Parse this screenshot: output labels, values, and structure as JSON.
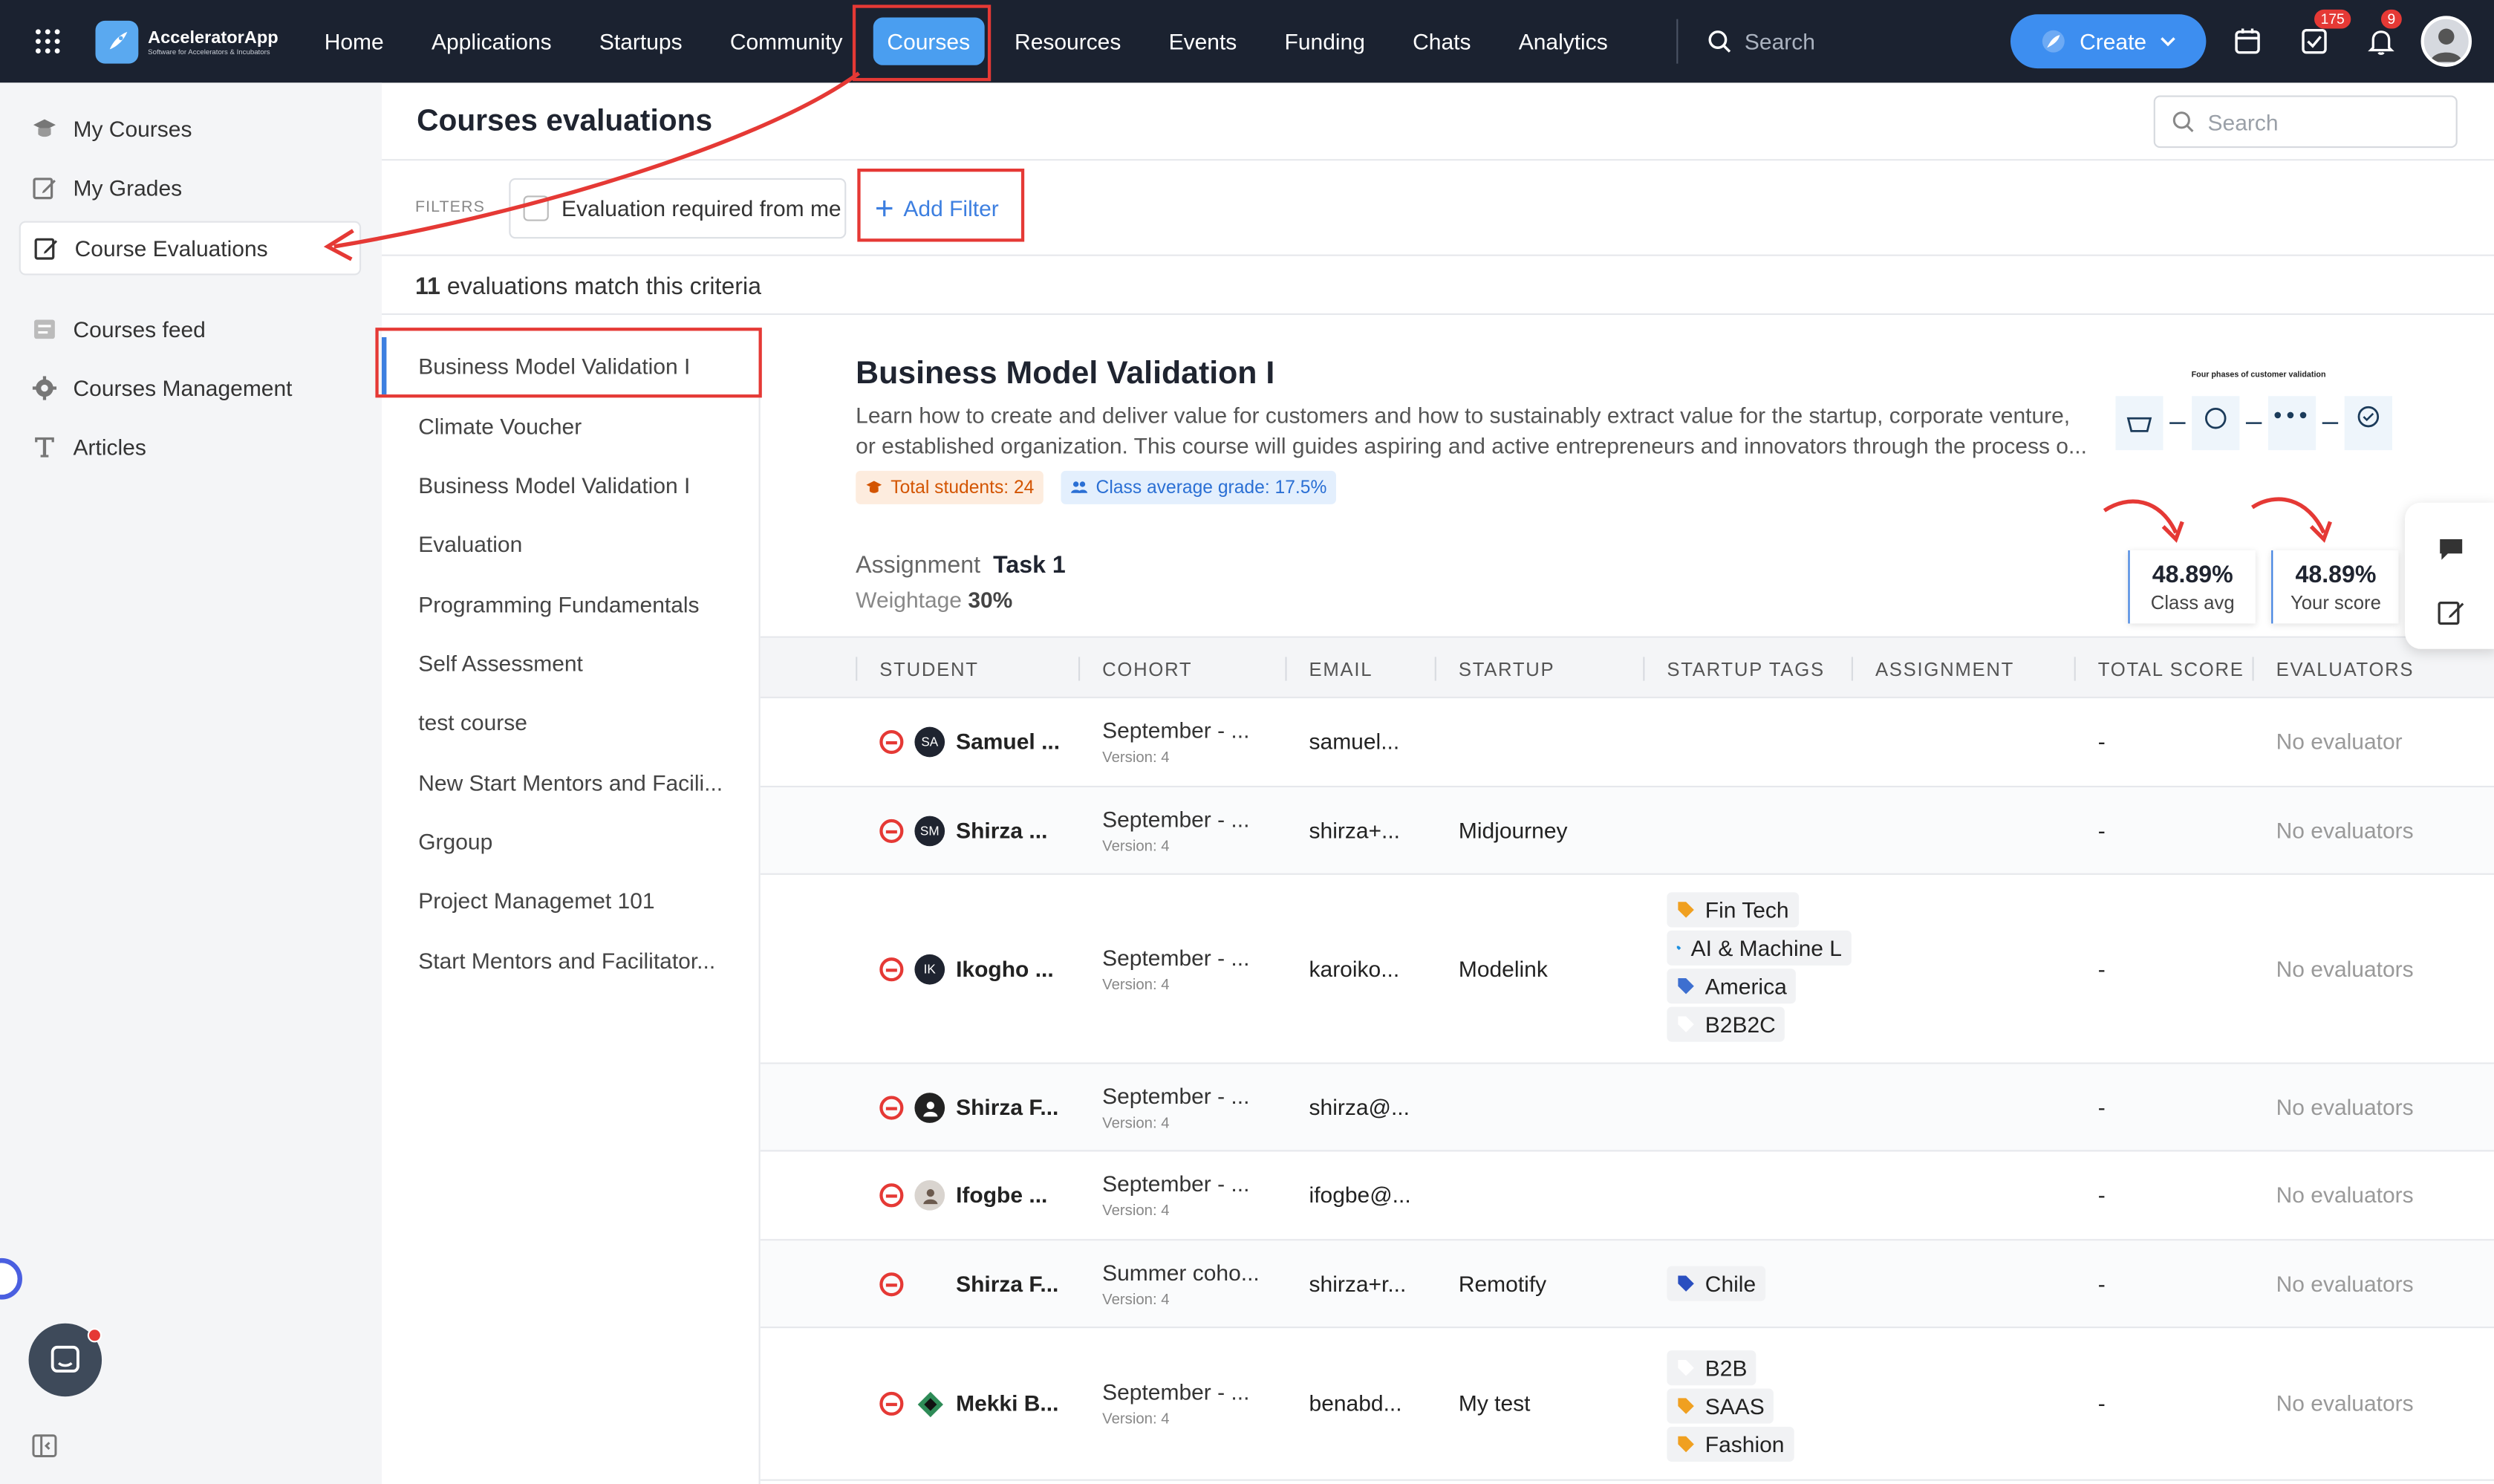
{
  "app": {
    "name": "AcceleratorApp",
    "tagline": "Software for Accelerators & Incubators"
  },
  "topnav": {
    "items": [
      {
        "label": "Home"
      },
      {
        "label": "Applications"
      },
      {
        "label": "Startups"
      },
      {
        "label": "Community"
      },
      {
        "label": "Courses",
        "active": true
      },
      {
        "label": "Resources"
      },
      {
        "label": "Events"
      },
      {
        "label": "Funding"
      },
      {
        "label": "Chats"
      },
      {
        "label": "Analytics"
      }
    ],
    "search_placeholder": "Search",
    "create_label": "Create",
    "tasks_badge": "175",
    "notifications_badge": "9"
  },
  "sidebar": {
    "items": [
      {
        "label": "My Courses",
        "icon": "graduation-icon"
      },
      {
        "label": "My Grades",
        "icon": "edit-icon"
      },
      {
        "label": "Course Evaluations",
        "icon": "edit-icon",
        "selected": true
      },
      {
        "label": "Courses feed",
        "icon": "feed-icon"
      },
      {
        "label": "Courses Management",
        "icon": "gear-icon"
      },
      {
        "label": "Articles",
        "icon": "text-icon"
      }
    ]
  },
  "main": {
    "title": "Courses evaluations",
    "search_placeholder": "Search",
    "filters_label": "FILTERS",
    "filter_checkbox_label": "Evaluation required from me",
    "add_filter_label": "Add Filter",
    "match_count": "11",
    "match_text": " evaluations match this criteria"
  },
  "courses": [
    "Business Model Validation I",
    "Climate Voucher",
    "Business Model Validation I",
    "Evaluation",
    "Programming Fundamentals",
    "Self Assessment",
    "test course",
    "New Start Mentors and Facili...",
    "Grgoup",
    "Project Managemet 101",
    "Start Mentors and Facilitator..."
  ],
  "detail": {
    "title": "Business Model Validation I",
    "description": "Learn how to create and deliver value for customers and how to sustainably extract value for the startup, corporate venture, or established organization. This course will guides aspiring and active entrepreneurs and innovators through the process o...",
    "total_students": "Total students: 24",
    "class_avg_grade": "Class average grade: 17.5%",
    "diagram_title": "Four phases of customer validation",
    "assignment_label": "Assignment",
    "assignment_name": "Task 1",
    "weightage_label": "Weightage",
    "weightage_value": "30%",
    "class_avg_value": "48.89%",
    "class_avg_label": "Class avg",
    "your_score_value": "48.89%",
    "your_score_label": "Your score"
  },
  "table": {
    "columns": [
      "STUDENT",
      "COHORT",
      "EMAIL",
      "STARTUP",
      "STARTUP TAGS",
      "ASSIGNMENT",
      "TOTAL SCORE",
      "EVALUATORS"
    ],
    "version_text": "Version: 4",
    "rows": [
      {
        "initials": "SA",
        "name": "Samuel ...",
        "cohort": "September - ...",
        "email": "samuel...",
        "startup": "",
        "tags": [],
        "score": "-",
        "evaluators": "No evaluator"
      },
      {
        "initials": "SM",
        "name": "Shirza ...",
        "cohort": "September - ...",
        "email": "shirza+...",
        "startup": "Midjourney",
        "tags": [],
        "score": "-",
        "evaluators": "No evaluators"
      },
      {
        "initials": "IK",
        "name": "Ikogho ...",
        "cohort": "September - ...",
        "email": "karoiko...",
        "startup": "Modelink",
        "tags": [
          {
            "label": "Fin Tech",
            "color": "#f0a020"
          },
          {
            "label": "AI & Machine L",
            "color": "#1e90e0"
          },
          {
            "label": "America",
            "color": "#3d6fd0"
          },
          {
            "label": "B2B2C",
            "color": "#ffffff"
          }
        ],
        "score": "-",
        "evaluators": "No evaluators"
      },
      {
        "initials": "",
        "name": "Shirza F...",
        "cohort": "September - ...",
        "email": "shirza@...",
        "startup": "",
        "tags": [],
        "score": "-",
        "evaluators": "No evaluators"
      },
      {
        "initials": "",
        "name": "Ifogbe ...",
        "cohort": "September - ...",
        "email": "ifogbe@...",
        "startup": "",
        "tags": [],
        "score": "-",
        "evaluators": "No evaluators"
      },
      {
        "initials": "",
        "name": "Shirza F...",
        "cohort": "Summer coho...",
        "email": "shirza+r...",
        "startup": "Remotify",
        "tags": [
          {
            "label": "Chile",
            "color": "#2a4fc0"
          }
        ],
        "score": "-",
        "evaluators": "No evaluators"
      },
      {
        "initials": "",
        "name": "Mekki B...",
        "cohort": "September - ...",
        "email": "benabd...",
        "startup": "My test",
        "tags": [
          {
            "label": "B2B",
            "color": "#ffffff"
          },
          {
            "label": "SAAS",
            "color": "#f0a020"
          },
          {
            "label": "Fashion",
            "color": "#f0a020"
          }
        ],
        "score": "-",
        "evaluators": "No evaluators"
      }
    ]
  }
}
